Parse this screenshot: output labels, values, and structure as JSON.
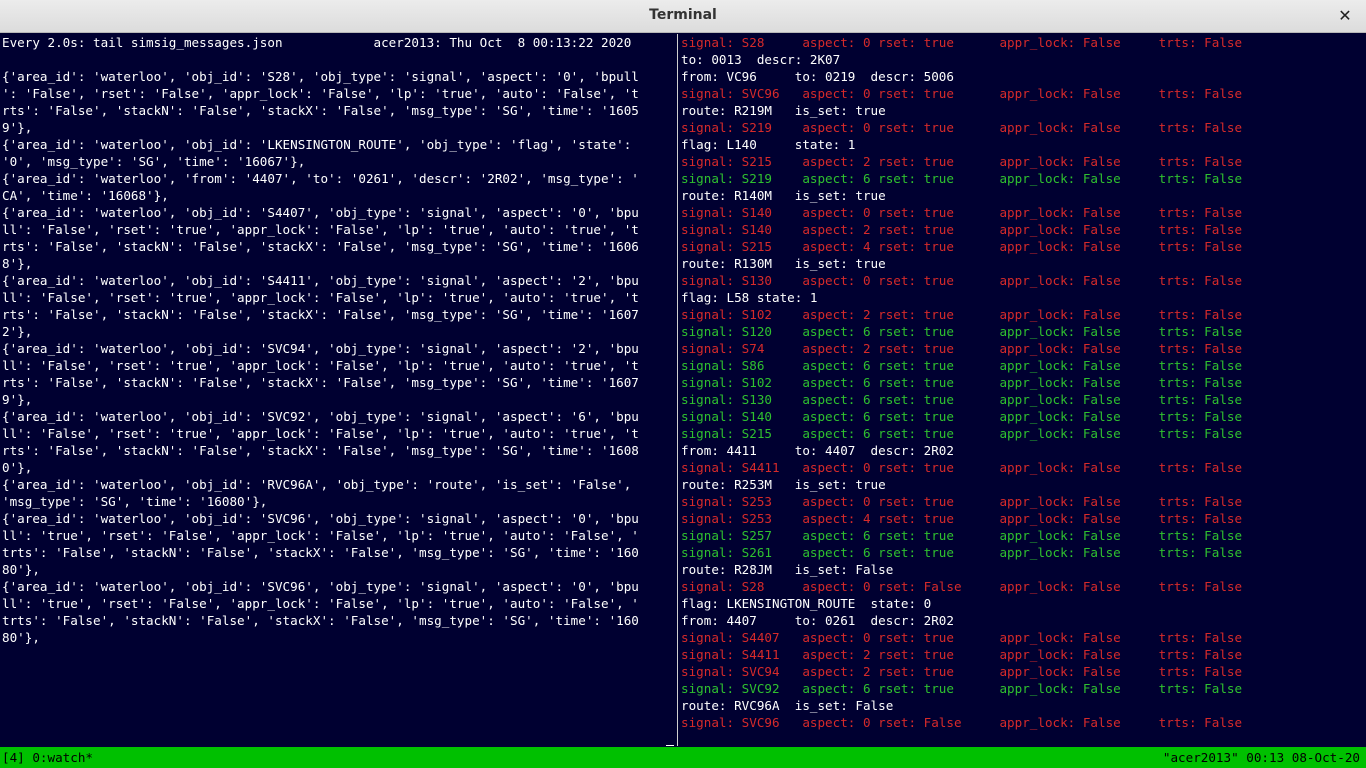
{
  "window": {
    "title": "Terminal",
    "close_glyph": "✕"
  },
  "left_pane": {
    "lines": [
      "Every 2.0s: tail simsig_messages.json            acer2013: Thu Oct  8 00:13:22 2020",
      "",
      "{'area_id': 'waterloo', 'obj_id': 'S28', 'obj_type': 'signal', 'aspect': '0', 'bpull",
      "': 'False', 'rset': 'False', 'appr_lock': 'False', 'lp': 'true', 'auto': 'False', 't",
      "rts': 'False', 'stackN': 'False', 'stackX': 'False', 'msg_type': 'SG', 'time': '1605",
      "9'},",
      "{'area_id': 'waterloo', 'obj_id': 'LKENSINGTON_ROUTE', 'obj_type': 'flag', 'state':",
      "'0', 'msg_type': 'SG', 'time': '16067'},",
      "{'area_id': 'waterloo', 'from': '4407', 'to': '0261', 'descr': '2R02', 'msg_type': '",
      "CA', 'time': '16068'},",
      "{'area_id': 'waterloo', 'obj_id': 'S4407', 'obj_type': 'signal', 'aspect': '0', 'bpu",
      "ll': 'False', 'rset': 'true', 'appr_lock': 'False', 'lp': 'true', 'auto': 'true', 't",
      "rts': 'False', 'stackN': 'False', 'stackX': 'False', 'msg_type': 'SG', 'time': '1606",
      "8'},",
      "{'area_id': 'waterloo', 'obj_id': 'S4411', 'obj_type': 'signal', 'aspect': '2', 'bpu",
      "ll': 'False', 'rset': 'true', 'appr_lock': 'False', 'lp': 'true', 'auto': 'true', 't",
      "rts': 'False', 'stackN': 'False', 'stackX': 'False', 'msg_type': 'SG', 'time': '1607",
      "2'},",
      "{'area_id': 'waterloo', 'obj_id': 'SVC94', 'obj_type': 'signal', 'aspect': '2', 'bpu",
      "ll': 'False', 'rset': 'true', 'appr_lock': 'False', 'lp': 'true', 'auto': 'true', 't",
      "rts': 'False', 'stackN': 'False', 'stackX': 'False', 'msg_type': 'SG', 'time': '1607",
      "9'},",
      "{'area_id': 'waterloo', 'obj_id': 'SVC92', 'obj_type': 'signal', 'aspect': '6', 'bpu",
      "ll': 'False', 'rset': 'true', 'appr_lock': 'False', 'lp': 'true', 'auto': 'true', 't",
      "rts': 'False', 'stackN': 'False', 'stackX': 'False', 'msg_type': 'SG', 'time': '1608",
      "0'},",
      "{'area_id': 'waterloo', 'obj_id': 'RVC96A', 'obj_type': 'route', 'is_set': 'False',",
      "'msg_type': 'SG', 'time': '16080'},",
      "{'area_id': 'waterloo', 'obj_id': 'SVC96', 'obj_type': 'signal', 'aspect': '0', 'bpu",
      "ll': 'true', 'rset': 'False', 'appr_lock': 'False', 'lp': 'true', 'auto': 'False', '",
      "trts': 'False', 'stackN': 'False', 'stackX': 'False', 'msg_type': 'SG', 'time': '160",
      "80'},",
      "{'area_id': 'waterloo', 'obj_id': 'SVC96', 'obj_type': 'signal', 'aspect': '0', 'bpu",
      "ll': 'true', 'rset': 'False', 'appr_lock': 'False', 'lp': 'true', 'auto': 'False', '",
      "trts': 'False', 'stackN': 'False', 'stackX': 'False', 'msg_type': 'SG', 'time': '160",
      "80'},"
    ]
  },
  "right_pane": {
    "lines": [
      {
        "text": "signal: S28     aspect: 0 rset: true      appr_lock: False     trts: False",
        "color": "red"
      },
      {
        "text": "to: 0013  descr: 2K07",
        "color": "white"
      },
      {
        "text": "from: VC96     to: 0219  descr: 5006",
        "color": "white"
      },
      {
        "text": "signal: SVC96   aspect: 0 rset: true      appr_lock: False     trts: False",
        "color": "red"
      },
      {
        "text": "route: R219M   is_set: true",
        "color": "white"
      },
      {
        "text": "signal: S219    aspect: 0 rset: true      appr_lock: False     trts: False",
        "color": "red"
      },
      {
        "text": "flag: L140     state: 1",
        "color": "white"
      },
      {
        "text": "signal: S215    aspect: 2 rset: true      appr_lock: False     trts: False",
        "color": "red"
      },
      {
        "text": "signal: S219    aspect: 6 rset: true      appr_lock: False     trts: False",
        "color": "green"
      },
      {
        "text": "route: R140M   is_set: true",
        "color": "white"
      },
      {
        "text": "signal: S140    aspect: 0 rset: true      appr_lock: False     trts: False",
        "color": "red"
      },
      {
        "text": "signal: S140    aspect: 2 rset: true      appr_lock: False     trts: False",
        "color": "red"
      },
      {
        "text": "signal: S215    aspect: 4 rset: true      appr_lock: False     trts: False",
        "color": "red"
      },
      {
        "text": "route: R130M   is_set: true",
        "color": "white"
      },
      {
        "text": "signal: S130    aspect: 0 rset: true      appr_lock: False     trts: False",
        "color": "red"
      },
      {
        "text": "flag: L58 state: 1",
        "color": "white"
      },
      {
        "text": "signal: S102    aspect: 2 rset: true      appr_lock: False     trts: False",
        "color": "red"
      },
      {
        "text": "signal: S120    aspect: 6 rset: true      appr_lock: False     trts: False",
        "color": "green"
      },
      {
        "text": "signal: S74     aspect: 2 rset: true      appr_lock: False     trts: False",
        "color": "red"
      },
      {
        "text": "signal: S86     aspect: 6 rset: true      appr_lock: False     trts: False",
        "color": "green"
      },
      {
        "text": "signal: S102    aspect: 6 rset: true      appr_lock: False     trts: False",
        "color": "green"
      },
      {
        "text": "signal: S130    aspect: 6 rset: true      appr_lock: False     trts: False",
        "color": "green"
      },
      {
        "text": "signal: S140    aspect: 6 rset: true      appr_lock: False     trts: False",
        "color": "green"
      },
      {
        "text": "signal: S215    aspect: 6 rset: true      appr_lock: False     trts: False",
        "color": "green"
      },
      {
        "text": "from: 4411     to: 4407  descr: 2R02",
        "color": "white"
      },
      {
        "text": "signal: S4411   aspect: 0 rset: true      appr_lock: False     trts: False",
        "color": "red"
      },
      {
        "text": "route: R253M   is_set: true",
        "color": "white"
      },
      {
        "text": "signal: S253    aspect: 0 rset: true      appr_lock: False     trts: False",
        "color": "red"
      },
      {
        "text": "signal: S253    aspect: 4 rset: true      appr_lock: False     trts: False",
        "color": "red"
      },
      {
        "text": "signal: S257    aspect: 6 rset: true      appr_lock: False     trts: False",
        "color": "green"
      },
      {
        "text": "signal: S261    aspect: 6 rset: true      appr_lock: False     trts: False",
        "color": "green"
      },
      {
        "text": "route: R28JM   is_set: False",
        "color": "white"
      },
      {
        "text": "signal: S28     aspect: 0 rset: False     appr_lock: False     trts: False",
        "color": "red"
      },
      {
        "text": "flag: LKENSINGTON_ROUTE  state: 0",
        "color": "white"
      },
      {
        "text": "from: 4407     to: 0261  descr: 2R02",
        "color": "white"
      },
      {
        "text": "signal: S4407   aspect: 0 rset: true      appr_lock: False     trts: False",
        "color": "red"
      },
      {
        "text": "signal: S4411   aspect: 2 rset: true      appr_lock: False     trts: False",
        "color": "red"
      },
      {
        "text": "signal: SVC94   aspect: 2 rset: true      appr_lock: False     trts: False",
        "color": "red"
      },
      {
        "text": "signal: SVC92   aspect: 6 rset: true      appr_lock: False     trts: False",
        "color": "green"
      },
      {
        "text": "route: RVC96A  is_set: False",
        "color": "white"
      },
      {
        "text": "signal: SVC96   aspect: 0 rset: False     appr_lock: False     trts: False",
        "color": "red"
      }
    ]
  },
  "status_bar": {
    "left": "[4] 0:watch*",
    "right": "\"acer2013\" 00:13 08-Oct-20"
  },
  "colors": {
    "background": "#000031",
    "status_bar": "#00c000",
    "red": "#d62a2a",
    "green": "#2fc02f",
    "white": "#ffffff"
  }
}
